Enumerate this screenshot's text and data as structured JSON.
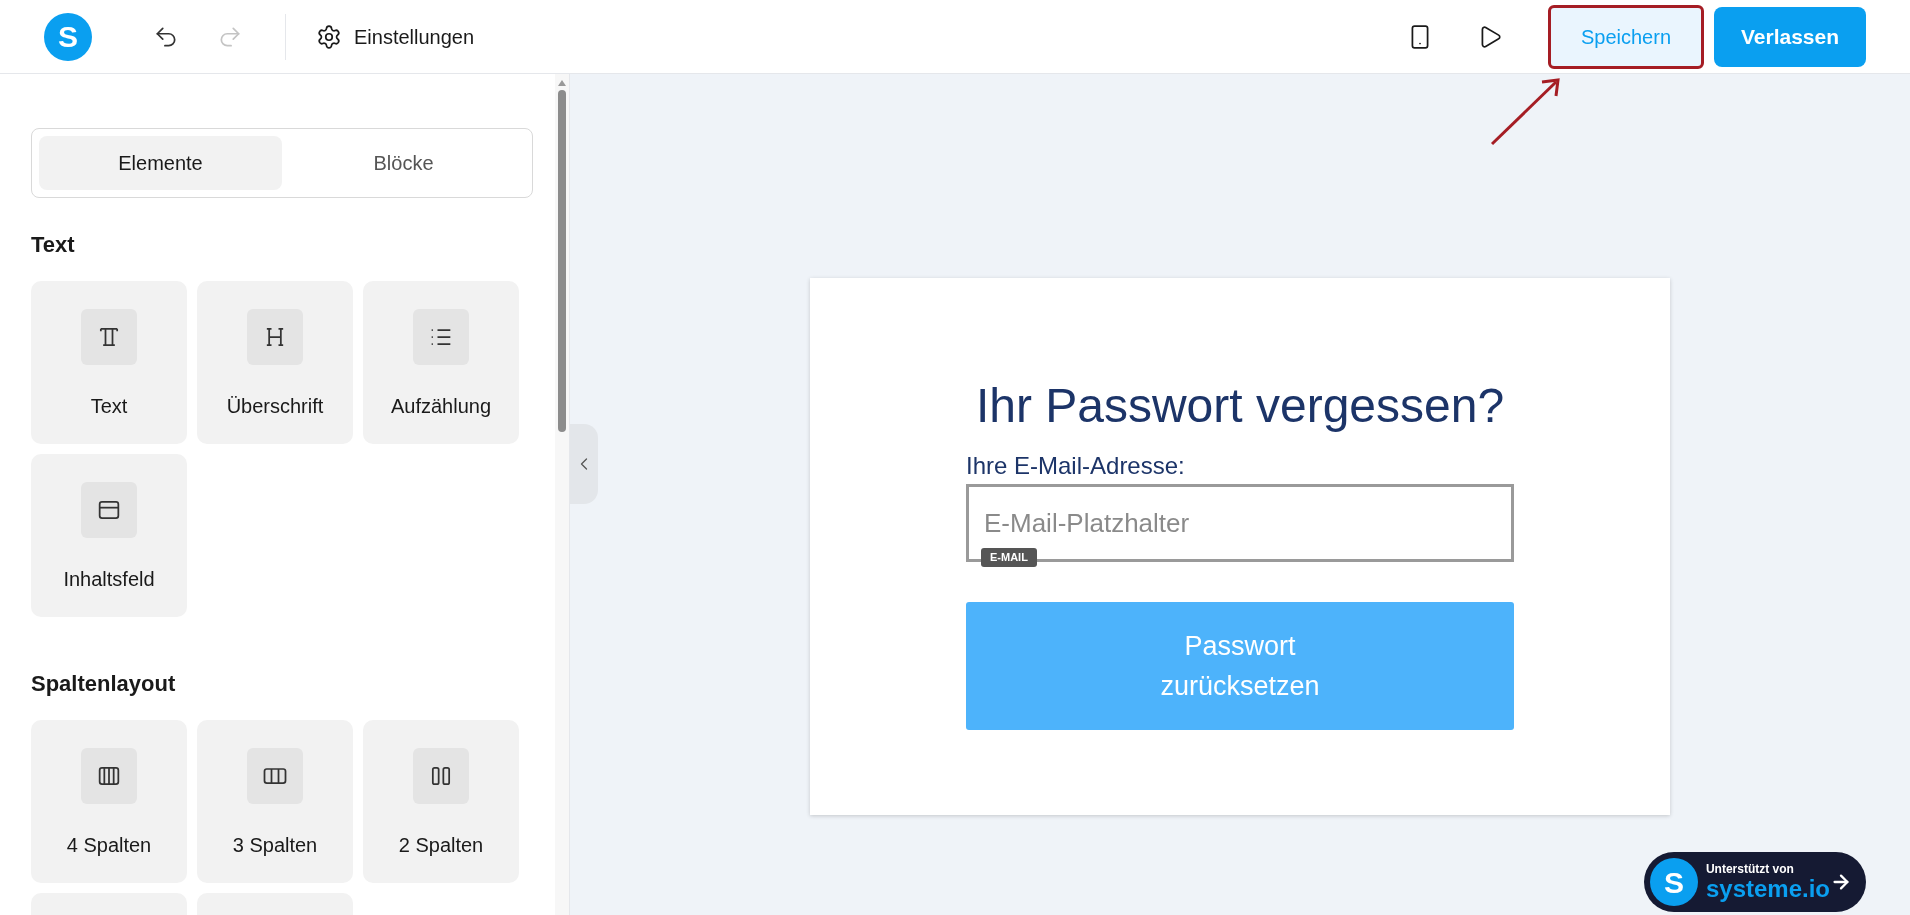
{
  "topbar": {
    "logo": "S",
    "settings": "Einstellungen",
    "save": {
      "label": "Speichern",
      "highlighted": true
    },
    "leave": "Verlassen"
  },
  "sidebar": {
    "tabs": [
      {
        "label": "Elemente",
        "selected": true
      },
      {
        "label": "Blöcke",
        "selected": false
      }
    ],
    "sections": [
      {
        "title": "Text",
        "items": [
          {
            "kind": "text",
            "label": "Text"
          },
          {
            "kind": "heading",
            "label": "Überschrift"
          },
          {
            "kind": "list",
            "label": "Aufzählung"
          },
          {
            "kind": "box",
            "label": "Inhaltsfeld"
          }
        ]
      },
      {
        "title": "Spaltenlayout",
        "items": [
          {
            "kind": "col4",
            "label": "4 Spalten"
          },
          {
            "kind": "col3",
            "label": "3 Spalten"
          },
          {
            "kind": "col2",
            "label": "2 Spalten"
          },
          {
            "kind": "cutoff"
          },
          {
            "kind": "cutoff"
          }
        ]
      }
    ]
  },
  "form": {
    "title": "Ihr Passwort vergessen?",
    "label": "Ihre E-Mail-Adresse:",
    "placeholder": "E-Mail-Platzhalter",
    "tag": "E-MAIL",
    "button": "Passwort zurücksetzen"
  },
  "badge": {
    "logo": "S",
    "line1": "Unterstützt von",
    "line2": "systeme.io"
  }
}
